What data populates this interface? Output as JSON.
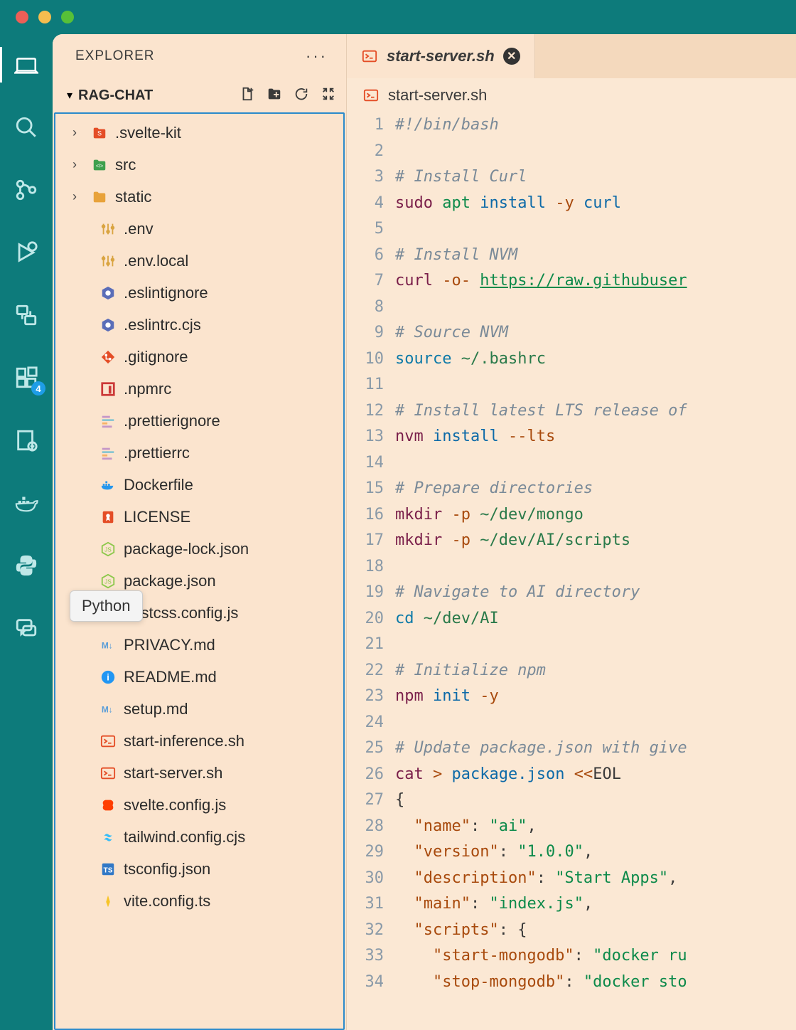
{
  "window": {
    "traffic_colors": [
      "#ec5f57",
      "#f5bd4f",
      "#57c038"
    ]
  },
  "activity_bar": {
    "items": [
      {
        "name": "explorer",
        "active": true
      },
      {
        "name": "search"
      },
      {
        "name": "source-control"
      },
      {
        "name": "run-debug"
      },
      {
        "name": "remote"
      },
      {
        "name": "extensions",
        "badge": "4"
      },
      {
        "name": "project-manager"
      },
      {
        "name": "docker"
      },
      {
        "name": "python"
      },
      {
        "name": "chat"
      }
    ]
  },
  "sidebar": {
    "title": "EXPLORER",
    "folder": "RAG-CHAT",
    "tree": [
      {
        "type": "folder",
        "name": ".svelte-kit",
        "icon": "svelte-folder",
        "color": "#e44d26"
      },
      {
        "type": "folder",
        "name": "src",
        "icon": "src-folder",
        "color": "#3fa04d"
      },
      {
        "type": "folder",
        "name": "static",
        "icon": "static-folder",
        "color": "#e8a23a"
      },
      {
        "type": "file",
        "name": ".env",
        "icon": "sliders",
        "color": "#d9a441"
      },
      {
        "type": "file",
        "name": ".env.local",
        "icon": "sliders",
        "color": "#d9a441"
      },
      {
        "type": "file",
        "name": ".eslintignore",
        "icon": "hex",
        "color": "#5a6db8"
      },
      {
        "type": "file",
        "name": ".eslintrc.cjs",
        "icon": "hex",
        "color": "#5a6db8"
      },
      {
        "type": "file",
        "name": ".gitignore",
        "icon": "git",
        "color": "#e44d26"
      },
      {
        "type": "file",
        "name": ".npmrc",
        "icon": "npm",
        "color": "#cb3837"
      },
      {
        "type": "file",
        "name": ".prettierignore",
        "icon": "prettier",
        "color": "#c596c7"
      },
      {
        "type": "file",
        "name": ".prettierrc",
        "icon": "prettier",
        "color": "#c596c7"
      },
      {
        "type": "file",
        "name": "Dockerfile",
        "icon": "docker",
        "color": "#2496ed"
      },
      {
        "type": "file",
        "name": "LICENSE",
        "icon": "license",
        "color": "#e44d26"
      },
      {
        "type": "file",
        "name": "package-lock.json",
        "icon": "nodejs",
        "color": "#8cc84b"
      },
      {
        "type": "file",
        "name": "package.json",
        "icon": "nodejs",
        "color": "#8cc84b"
      },
      {
        "type": "file",
        "name": "postcss.config.js",
        "icon": "postcss",
        "color": "#dd3a0a"
      },
      {
        "type": "file",
        "name": "PRIVACY.md",
        "icon": "md",
        "color": "#5a9dd8"
      },
      {
        "type": "file",
        "name": "README.md",
        "icon": "info",
        "color": "#2196f3"
      },
      {
        "type": "file",
        "name": "setup.md",
        "icon": "md",
        "color": "#5a9dd8"
      },
      {
        "type": "file",
        "name": "start-inference.sh",
        "icon": "shell",
        "color": "#e44d26"
      },
      {
        "type": "file",
        "name": "start-server.sh",
        "icon": "shell",
        "color": "#e44d26"
      },
      {
        "type": "file",
        "name": "svelte.config.js",
        "icon": "svelte",
        "color": "#ff3e00"
      },
      {
        "type": "file",
        "name": "tailwind.config.cjs",
        "icon": "tailwind",
        "color": "#38bdf8"
      },
      {
        "type": "file",
        "name": "tsconfig.json",
        "icon": "ts",
        "color": "#3178c6"
      },
      {
        "type": "file",
        "name": "vite.config.ts",
        "icon": "vite",
        "color": "#f7c427"
      }
    ]
  },
  "tabs": [
    {
      "label": "start-server.sh",
      "icon": "shell",
      "dirty": true
    }
  ],
  "breadcrumb": "start-server.sh",
  "tooltip": "Python",
  "code": {
    "lines": [
      [
        {
          "t": "comment",
          "v": "#!/bin/bash"
        }
      ],
      [],
      [
        {
          "t": "comment",
          "v": "# Install Curl"
        }
      ],
      [
        {
          "t": "cmd",
          "v": "sudo"
        },
        {
          "t": "sp"
        },
        {
          "t": "kw",
          "v": "apt"
        },
        {
          "t": "sp"
        },
        {
          "t": "arg",
          "v": "install"
        },
        {
          "t": "sp"
        },
        {
          "t": "flag",
          "v": "-y"
        },
        {
          "t": "sp"
        },
        {
          "t": "arg",
          "v": "curl"
        }
      ],
      [],
      [
        {
          "t": "comment",
          "v": "# Install NVM"
        }
      ],
      [
        {
          "t": "cmd",
          "v": "curl"
        },
        {
          "t": "sp"
        },
        {
          "t": "flag",
          "v": "-o-"
        },
        {
          "t": "sp"
        },
        {
          "t": "url",
          "v": "https://raw.githubuser"
        }
      ],
      [],
      [
        {
          "t": "comment",
          "v": "# Source NVM"
        }
      ],
      [
        {
          "t": "builtin",
          "v": "source"
        },
        {
          "t": "sp"
        },
        {
          "t": "path",
          "v": "~/.bashrc"
        }
      ],
      [],
      [
        {
          "t": "comment",
          "v": "# Install latest LTS release of"
        }
      ],
      [
        {
          "t": "cmd",
          "v": "nvm"
        },
        {
          "t": "sp"
        },
        {
          "t": "arg",
          "v": "install"
        },
        {
          "t": "sp"
        },
        {
          "t": "flag",
          "v": "--lts"
        }
      ],
      [],
      [
        {
          "t": "comment",
          "v": "# Prepare directories"
        }
      ],
      [
        {
          "t": "cmd",
          "v": "mkdir"
        },
        {
          "t": "sp"
        },
        {
          "t": "flag",
          "v": "-p"
        },
        {
          "t": "sp"
        },
        {
          "t": "path",
          "v": "~/dev/mongo"
        }
      ],
      [
        {
          "t": "cmd",
          "v": "mkdir"
        },
        {
          "t": "sp"
        },
        {
          "t": "flag",
          "v": "-p"
        },
        {
          "t": "sp"
        },
        {
          "t": "path",
          "v": "~/dev/AI/scripts"
        }
      ],
      [],
      [
        {
          "t": "comment",
          "v": "# Navigate to AI directory"
        }
      ],
      [
        {
          "t": "builtin",
          "v": "cd"
        },
        {
          "t": "sp"
        },
        {
          "t": "path",
          "v": "~/dev/AI"
        }
      ],
      [],
      [
        {
          "t": "comment",
          "v": "# Initialize npm"
        }
      ],
      [
        {
          "t": "cmd",
          "v": "npm"
        },
        {
          "t": "sp"
        },
        {
          "t": "arg",
          "v": "init"
        },
        {
          "t": "sp"
        },
        {
          "t": "flag",
          "v": "-y"
        }
      ],
      [],
      [
        {
          "t": "comment",
          "v": "# Update package.json with give"
        }
      ],
      [
        {
          "t": "cmd",
          "v": "cat"
        },
        {
          "t": "sp"
        },
        {
          "t": "op",
          "v": ">"
        },
        {
          "t": "sp"
        },
        {
          "t": "arg",
          "v": "package.json"
        },
        {
          "t": "sp"
        },
        {
          "t": "op",
          "v": "<<"
        },
        {
          "t": "punct",
          "v": "EOL"
        }
      ],
      [
        {
          "t": "punct",
          "v": "{"
        }
      ],
      [
        {
          "t": "indent",
          "v": "  "
        },
        {
          "t": "key",
          "v": "\"name\""
        },
        {
          "t": "punct",
          "v": ": "
        },
        {
          "t": "str",
          "v": "\"ai\""
        },
        {
          "t": "punct",
          "v": ","
        }
      ],
      [
        {
          "t": "indent",
          "v": "  "
        },
        {
          "t": "key",
          "v": "\"version\""
        },
        {
          "t": "punct",
          "v": ": "
        },
        {
          "t": "str",
          "v": "\"1.0.0\""
        },
        {
          "t": "punct",
          "v": ","
        }
      ],
      [
        {
          "t": "indent",
          "v": "  "
        },
        {
          "t": "key",
          "v": "\"description\""
        },
        {
          "t": "punct",
          "v": ": "
        },
        {
          "t": "str",
          "v": "\"Start Apps\""
        },
        {
          "t": "punct",
          "v": ","
        }
      ],
      [
        {
          "t": "indent",
          "v": "  "
        },
        {
          "t": "key",
          "v": "\"main\""
        },
        {
          "t": "punct",
          "v": ": "
        },
        {
          "t": "str",
          "v": "\"index.js\""
        },
        {
          "t": "punct",
          "v": ","
        }
      ],
      [
        {
          "t": "indent",
          "v": "  "
        },
        {
          "t": "key",
          "v": "\"scripts\""
        },
        {
          "t": "punct",
          "v": ": {"
        }
      ],
      [
        {
          "t": "indent",
          "v": "    "
        },
        {
          "t": "key",
          "v": "\"start-mongodb\""
        },
        {
          "t": "punct",
          "v": ": "
        },
        {
          "t": "str",
          "v": "\"docker ru"
        }
      ],
      [
        {
          "t": "indent",
          "v": "    "
        },
        {
          "t": "key",
          "v": "\"stop-mongodb\""
        },
        {
          "t": "punct",
          "v": ": "
        },
        {
          "t": "str",
          "v": "\"docker sto"
        }
      ]
    ]
  }
}
